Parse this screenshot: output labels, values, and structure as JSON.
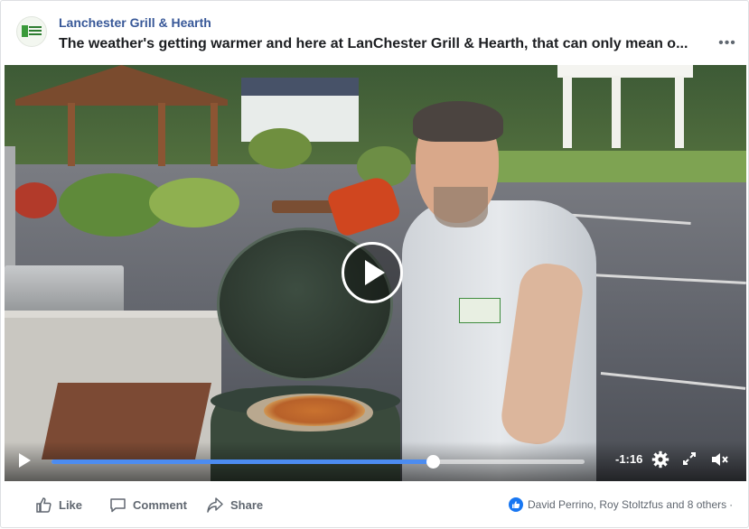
{
  "post": {
    "page_name": "Lanchester Grill & Hearth",
    "title": "The weather's getting warmer and here at LanChester Grill & Hearth, that can only mean o...",
    "more_icon": "ellipsis-icon"
  },
  "video": {
    "time_remaining": "-1:16",
    "progress": 0.715,
    "play_icon": "play-icon",
    "settings_icon": "gear-icon",
    "fullscreen_icon": "expand-icon",
    "mute_icon": "speaker-muted-icon"
  },
  "actions": {
    "like_label": "Like",
    "comment_label": "Comment",
    "share_label": "Share"
  },
  "reactions": {
    "summary": "David Perrino, Roy Stoltzfus and 8 others",
    "icon": "like-reaction-icon",
    "color": "#1877f2"
  },
  "colors": {
    "page_name": "#385898",
    "progress_fill": "#4c8cf0",
    "action_text": "#606770"
  }
}
